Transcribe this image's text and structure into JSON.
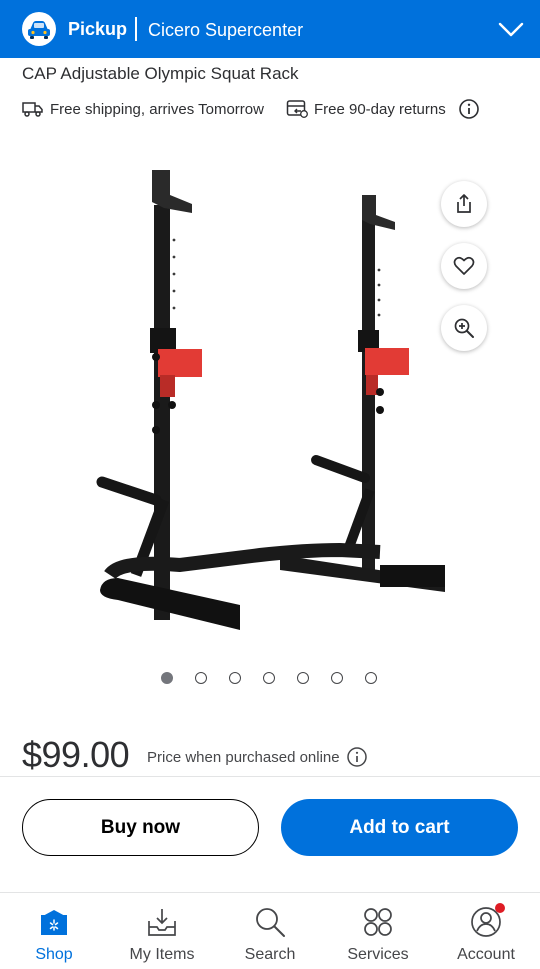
{
  "header": {
    "pickup_label": "Pickup",
    "store_name": "Cicero Supercenter",
    "brand_color": "#0071dc"
  },
  "product": {
    "title": "CAP Adjustable Olympic Squat Rack",
    "shipping_text": "Free shipping, arrives Tomorrow",
    "returns_text": "Free 90-day returns",
    "image_alt_icon": "squat-rack-photo",
    "carousel": {
      "count": 7,
      "active_index": 0
    },
    "price": "$99.00",
    "price_note": "Price when purchased online"
  },
  "image_actions": [
    "share-icon",
    "heart-icon",
    "zoom-in-icon"
  ],
  "actions": {
    "buy_now": "Buy now",
    "add_to_cart": "Add to cart"
  },
  "nav": {
    "items": [
      {
        "label": "Shop",
        "icon": "shop-icon",
        "active": true
      },
      {
        "label": "My Items",
        "icon": "my-items-icon",
        "active": false
      },
      {
        "label": "Search",
        "icon": "search-icon",
        "active": false
      },
      {
        "label": "Services",
        "icon": "services-icon",
        "active": false
      },
      {
        "label": "Account",
        "icon": "account-icon",
        "active": false
      }
    ]
  },
  "colors": {
    "accent": "#0071dc",
    "rack_black": "#1c1c1c",
    "rack_red": "#e23b35",
    "notification": "#de1c24"
  }
}
